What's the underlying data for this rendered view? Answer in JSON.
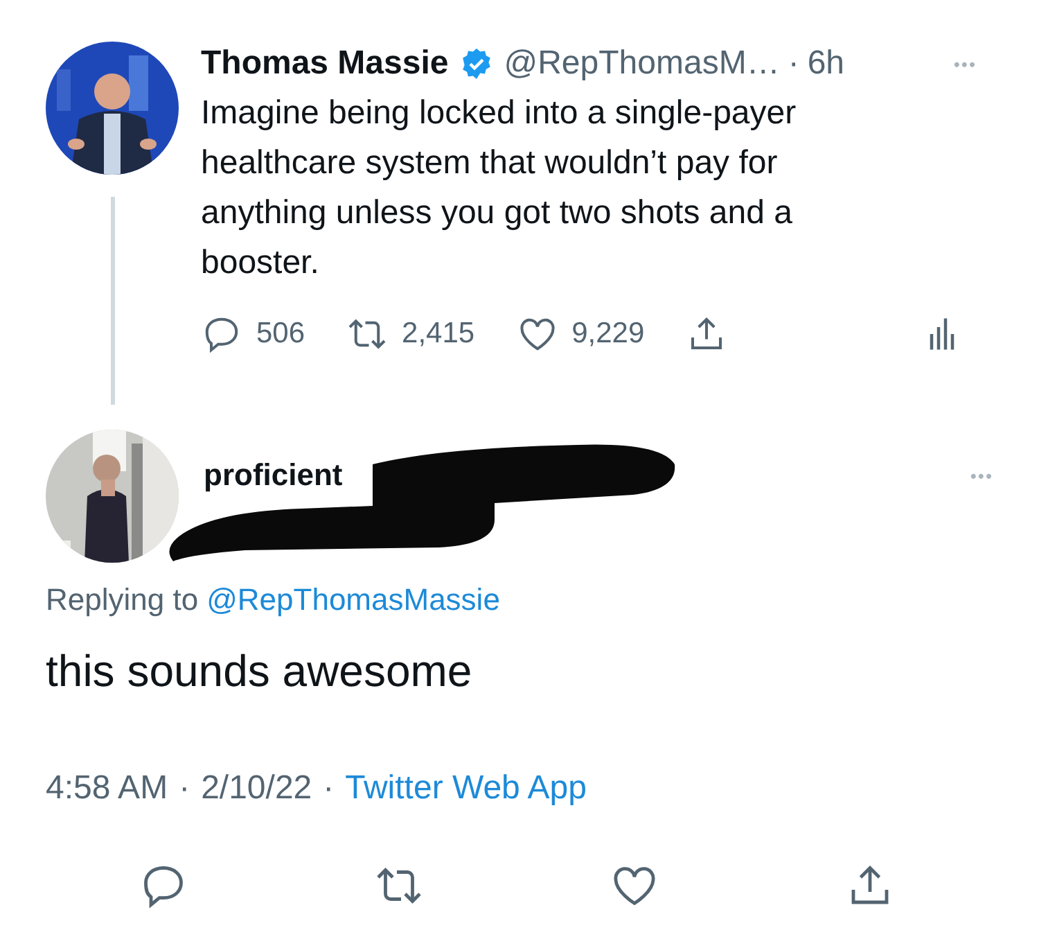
{
  "tweet": {
    "name": "Thomas Massie",
    "verified": true,
    "handle": "@RepThomasM…",
    "separator": "·",
    "time": "6h",
    "more": "•••",
    "text": "Imagine being locked into a single-payer healthcare system that wouldn’t pay for anything unless you got two shots and a booster.",
    "actions": [
      {
        "kind": "reply",
        "count": "506"
      },
      {
        "kind": "retweet",
        "count": "2,415"
      },
      {
        "kind": "like",
        "count": "9,229"
      },
      {
        "kind": "share"
      }
    ]
  },
  "reply": {
    "name": "proficient",
    "redacted": true,
    "more": "•••",
    "replying_label": "Replying to",
    "replying_to": "@RepThomasMassie",
    "text": "this sounds awesome",
    "time": "4:58 AM",
    "meta_separator": "·",
    "date": "2/10/22",
    "source": "Twitter Web App",
    "actions": [
      {
        "kind": "reply"
      },
      {
        "kind": "retweet"
      },
      {
        "kind": "like"
      },
      {
        "kind": "share"
      }
    ]
  }
}
